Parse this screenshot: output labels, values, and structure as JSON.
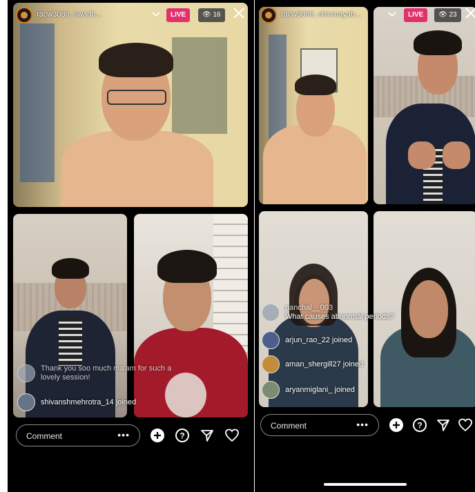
{
  "left": {
    "header": {
      "username": "racw3080, swadh...",
      "live_label": "LIVE",
      "viewers": "👁 16"
    },
    "comments": [
      {
        "text": "Thank you soo much ma'am for such a",
        "text2": "lovely session!"
      },
      {
        "text": "shivanshmehrotra_14 joined"
      }
    ],
    "comment_box": {
      "placeholder": "Comment",
      "more": "•••"
    }
  },
  "right": {
    "header": {
      "username": "racw3080, chinmayab...",
      "live_label": "LIVE",
      "viewers": "👁 23"
    },
    "comments": [
      {
        "user": "panchal__003",
        "text": "What causes abnormal periods?"
      },
      {
        "text": "arjun_rao_22 joined"
      },
      {
        "text": "aman_shergill27 joined"
      },
      {
        "text": "aryanmiglani_ joined"
      }
    ],
    "comment_box": {
      "placeholder": "Comment",
      "more": "•••"
    }
  },
  "icons": [
    "avatar",
    "chevron-down-icon",
    "close-icon",
    "add-icon",
    "question-icon",
    "send-icon",
    "heart-icon"
  ],
  "colors": {
    "live": "#e1306c",
    "background": "#000000",
    "text": "#ffffff"
  }
}
